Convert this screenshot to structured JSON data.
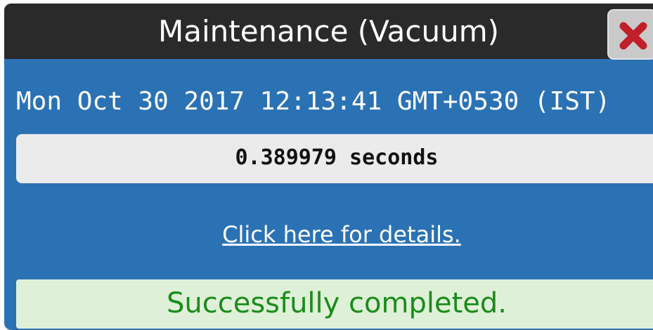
{
  "dialog": {
    "title": "Maintenance (Vacuum)",
    "close_icon": "close-x-icon",
    "timestamp": "Mon Oct 30 2017 12:13:41 GMT+0530 (IST)",
    "duration": "0.389979 seconds",
    "details_link": "Click here for details.",
    "status": "Successfully completed."
  },
  "colors": {
    "titlebar": "#2a2a2a",
    "body": "#2b72b5",
    "close_x": "#c0202a",
    "success_bg": "#dff0d8",
    "success_text": "#1a8c1a"
  }
}
